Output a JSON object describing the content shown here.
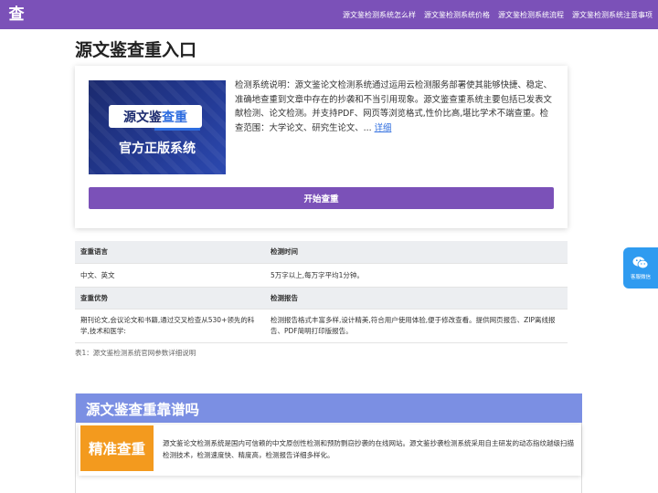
{
  "topbar": {
    "logo_char": "查",
    "nav": [
      "源文鉴检测系统怎么样",
      "源文鉴检测系统价格",
      "源文鉴检测系统流程",
      "源文鉴检测系统注意事项"
    ],
    "color": "#7b51b8"
  },
  "page": {
    "title": "源文鉴查重入口"
  },
  "intro": {
    "banner": {
      "pill_text_a": "源文鉴",
      "pill_text_b": "查重",
      "subtitle": "官方正版系统"
    },
    "description": "检测系统说明：源文鉴论文检测系统通过运用云检测服务部署使其能够快捷、稳定、准确地查重到文章中存在的抄袭和不当引用现象。源文鉴查重系统主要包括已发表文献检测、论文检测。并支持PDF、网页等浏览格式,性价比高,堪比学术不端查重。检查范围：大学论文、研究生论文、...",
    "more_link": "详细",
    "start_button": "开始查重"
  },
  "info_table": {
    "rows": [
      {
        "type": "head",
        "cells": [
          "查重语言",
          "检测时间"
        ]
      },
      {
        "type": "row",
        "cells": [
          "中文、英文",
          "5万字以上,每万字平均1分钟。"
        ]
      },
      {
        "type": "head",
        "cells": [
          "查重优势",
          "检测报告"
        ]
      },
      {
        "type": "row",
        "cells": [
          "期刊论文,会议论文和书籍,通过交叉检查从530+领先的科学,技术和医学:",
          "检测报告格式丰富多样,设计精美,符合用户使用体验,便于修改查看。提供网页报告、ZIP离线报告、PDF简明打印版报告。"
        ]
      }
    ],
    "caption": "表1：源文鉴检测系统官网参数详细说明"
  },
  "reliable_section": {
    "title": "源文鉴查重靠谱吗",
    "header_color": "#7b8fe3",
    "feature_tag": "精准查重",
    "feature_tag_color": "#f39a1e",
    "feature_text": "源文鉴论文检测系统是国内可信赖的中文原创性检测和预防剽窃抄袭的在线网站。源文鉴抄袭检测系统采用自主研发的动态指纹越级扫描检测技术，检测速度快、精度高，检测报告详细多样化。"
  },
  "floating_contact": {
    "label": "客服微信",
    "icon": "wechat-icon",
    "color": "#2f9bf0"
  }
}
